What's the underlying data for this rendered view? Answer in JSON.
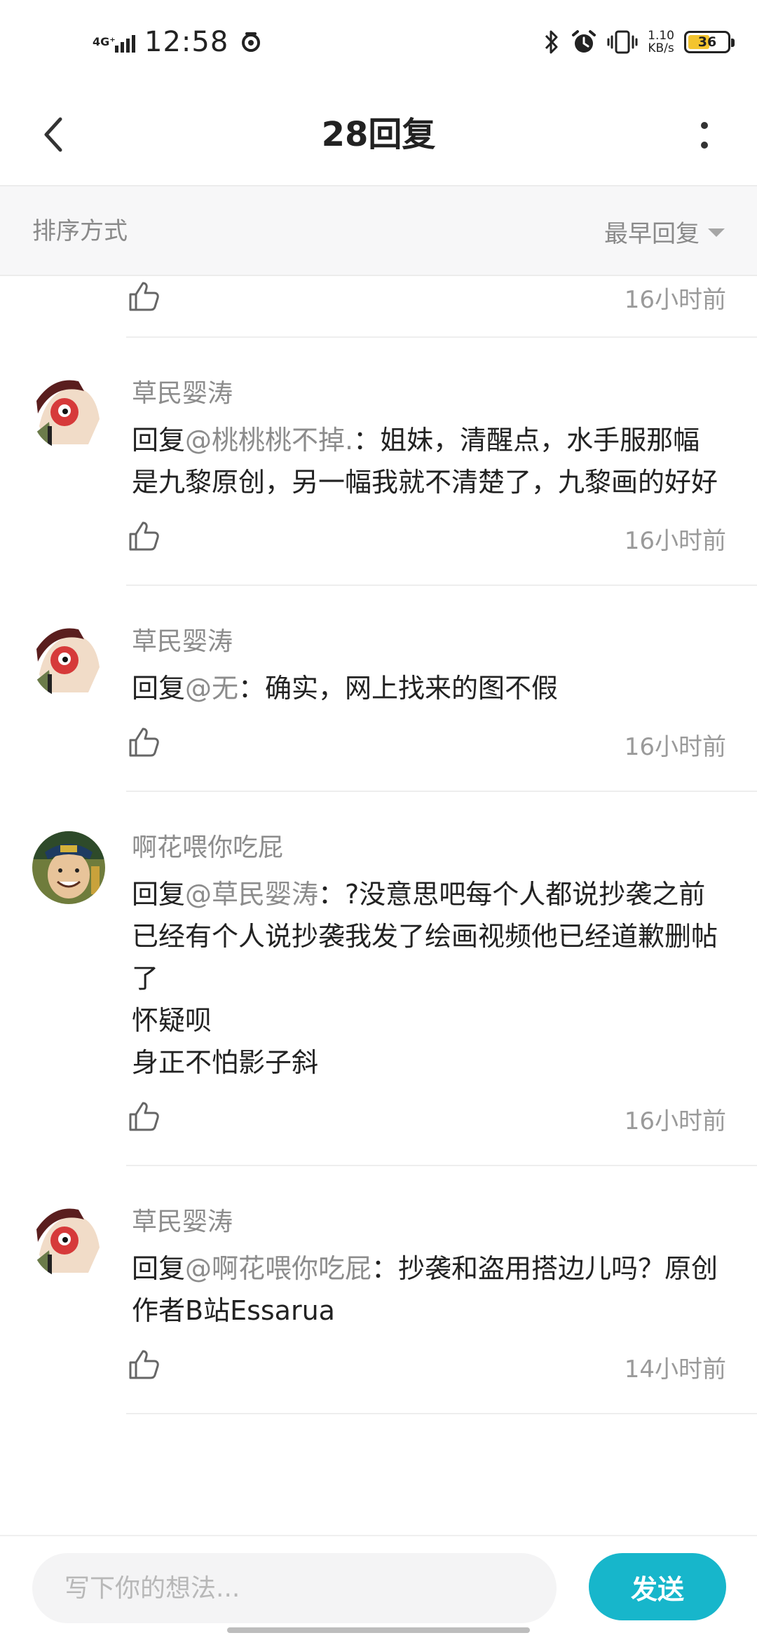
{
  "status_bar": {
    "network": "4G⁺",
    "time": "12:58",
    "speed_value": "1.10",
    "speed_unit": "KB/s",
    "battery": "36"
  },
  "header": {
    "title": "28回复",
    "back_icon": "chevron-left-icon",
    "more_icon": "more-vertical-icon"
  },
  "sort": {
    "label": "排序方式",
    "selected": "最早回复"
  },
  "partial_row": {
    "time": "16小时前"
  },
  "replies": [
    {
      "name": "草民婴涛",
      "prefix": "回复",
      "mention": "@桃桃桃不掉.",
      "text": "：姐妹，清醒点，水手服那幅是九黎原创，另一幅我就不清楚了，九黎画的好好",
      "time": "16小时前"
    },
    {
      "name": "草民婴涛",
      "prefix": "回复",
      "mention": "@无",
      "text": "：确实，网上找来的图不假",
      "time": "16小时前"
    },
    {
      "name": "啊花喂你吃屁",
      "prefix": "回复",
      "mention": "@草民婴涛",
      "text": "：?没意思吧每个人都说抄袭之前已经有个人说抄袭我发了绘画视频他已经道歉删帖了\n怀疑呗\n身正不怕影子斜",
      "time": "16小时前"
    },
    {
      "name": "草民婴涛",
      "prefix": "回复",
      "mention": "@啊花喂你吃屁",
      "text": "：抄袭和盗用搭边儿吗？原创作者B站Essarua",
      "time": "14小时前"
    }
  ],
  "composer": {
    "placeholder": "写下你的想法...",
    "send_label": "发送"
  },
  "colors": {
    "accent": "#17b6cb",
    "muted_text": "#8c8c8c",
    "battery": "#f3c42e"
  }
}
